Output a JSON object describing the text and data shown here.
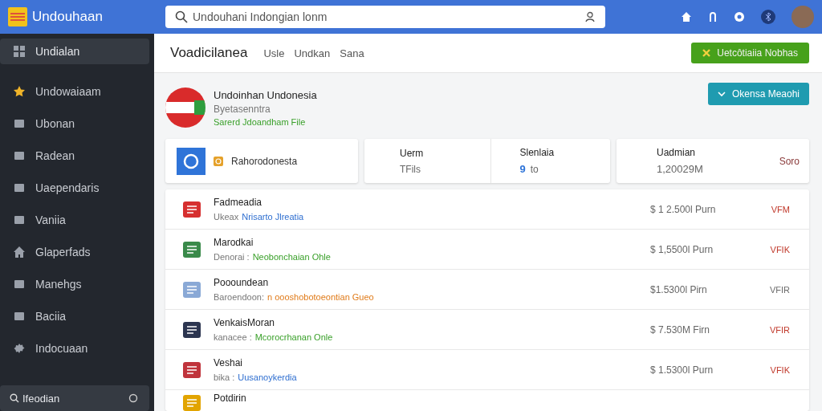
{
  "header": {
    "app_name": "Undouhaan",
    "search": {
      "value": "Undouhani Indongian lonm"
    }
  },
  "sidebar": {
    "items": [
      {
        "label": "Undialan",
        "selected": true
      },
      {
        "label": "Undowaiaam",
        "selected": false
      },
      {
        "label": "Ubonan",
        "selected": false
      },
      {
        "label": "Radean",
        "selected": false
      },
      {
        "label": "Uaependaris",
        "selected": false
      },
      {
        "label": "Vaniia",
        "selected": false
      },
      {
        "label": "Glaperfads",
        "selected": false
      },
      {
        "label": "Manehgs",
        "selected": false
      },
      {
        "label": "Baciia",
        "selected": false
      },
      {
        "label": "Indocuaan",
        "selected": false
      }
    ],
    "search": {
      "value": "Ifeodian"
    }
  },
  "toolbar": {
    "title": "Voadicilanea",
    "breadcrumbs": [
      "Usle",
      "Undkan",
      "Sana"
    ],
    "button": "Uetcôtiaiia Nobhas"
  },
  "profile": {
    "name": "Undoinhan Undonesia",
    "subtitle": "Byetasenntra",
    "link": "Sarerd Jdoandham File",
    "button": "Okensa Meaohi"
  },
  "stats": {
    "card_1": {
      "label": "Rahorodonesta"
    },
    "card_2": [
      {
        "heading": "Uerm",
        "value": "TFils"
      },
      {
        "heading": "Slenlaia",
        "value": "to",
        "badge": "9"
      }
    ],
    "card_3": {
      "heading": "Uadmian",
      "value": "1,20029M",
      "note": "Soro"
    }
  },
  "rows": [
    {
      "name": "Fadmeadia",
      "label": "Ukeax",
      "value": "Nrisarto Jlreatia",
      "color": "#2f6fd0",
      "price": "$ 1 2.500l Purn",
      "action": "VFM",
      "highlighted": true
    },
    {
      "name": "Marodkai",
      "label": "Denorai :",
      "value": "Neobonchaian Ohle",
      "color": "#3aa02a",
      "price": "$ 1,5500l Purn",
      "action": "VFIK",
      "highlighted": true
    },
    {
      "name": "Poooundean",
      "label": "Baroendoon:",
      "value": "n oooshobotoeontian Gueo",
      "color": "#e07b1a",
      "price": "$1.5300l Pirn",
      "action": "VFIR",
      "highlighted": false
    },
    {
      "name": "VenkaisMoran",
      "label": "kanacee :",
      "value": "Mcorocrhanan Onle",
      "color": "#3aa02a",
      "price": "$ 7.530M Firn",
      "action": "VFIR",
      "highlighted": true
    },
    {
      "name": "Veshai",
      "label": "bika :",
      "value": "Uusanoykerdia",
      "color": "#2f6fd0",
      "price": "$ 1.5300l Purn",
      "action": "VFIK",
      "highlighted": true
    },
    {
      "name": "Potdirin"
    }
  ]
}
